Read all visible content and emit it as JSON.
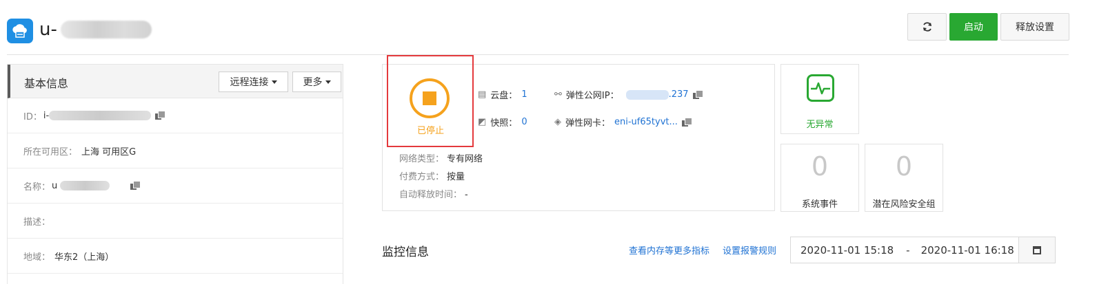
{
  "header": {
    "instance_name_prefix": "u-",
    "refresh_icon": "refresh-icon",
    "start_label": "启动",
    "release_label": "释放设置",
    "accent_green": "#29a832"
  },
  "basic_info": {
    "title": "基本信息",
    "remote_connect_label": "远程连接",
    "more_label": "更多",
    "rows": [
      {
        "label": "ID：",
        "value": "i-"
      },
      {
        "label": "所在可用区：",
        "value": "上海 可用区G"
      },
      {
        "label": "名称：",
        "value": "u"
      },
      {
        "label": "描述：",
        "value": ""
      },
      {
        "label": "地域：",
        "value": "华东2（上海）"
      }
    ]
  },
  "status": {
    "label": "已停止",
    "color": "#f5a21d",
    "cloud_disk_label": "云盘：",
    "cloud_disk_value": "1",
    "snapshot_label": "快照：",
    "snapshot_value": "0",
    "eip_label": "弹性公网IP：",
    "eip_suffix": ".237",
    "eni_label": "弹性网卡：",
    "eni_value": "eni-uf65tyvt...",
    "network_type_label": "网络类型：",
    "network_type_value": "专有网络",
    "billing_label": "付费方式：",
    "billing_value": "按量",
    "auto_release_label": "自动释放时间：",
    "auto_release_value": "-"
  },
  "cards": {
    "health_label": "无异常",
    "system_events_count": "0",
    "system_events_label": "系统事件",
    "risk_groups_count": "0",
    "risk_groups_label": "潜在风险安全组"
  },
  "monitor": {
    "title": "监控信息",
    "more_metrics_link": "查看内存等更多指标",
    "alarm_link": "设置报警规则",
    "start_time": "2020-11-01 15:18",
    "separator": "-",
    "end_time": "2020-11-01 16:18"
  }
}
